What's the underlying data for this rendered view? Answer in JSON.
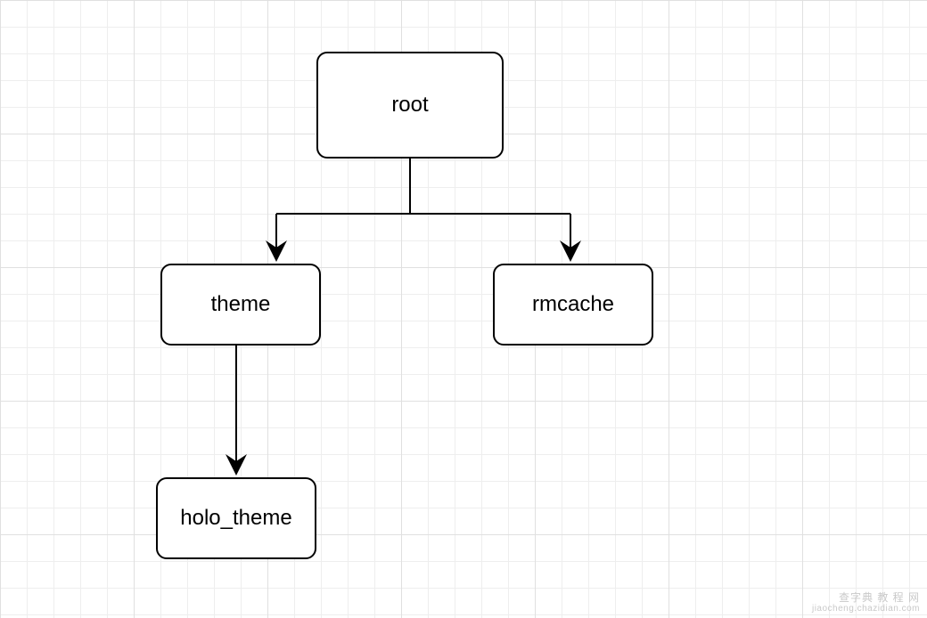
{
  "nodes": {
    "root": {
      "label": "root"
    },
    "theme": {
      "label": "theme"
    },
    "rmcache": {
      "label": "rmcache"
    },
    "holo_theme": {
      "label": "holo_theme"
    }
  },
  "watermark": {
    "line1": "查字典 教 程 网",
    "line2": "jiaocheng.chazidian.com"
  }
}
